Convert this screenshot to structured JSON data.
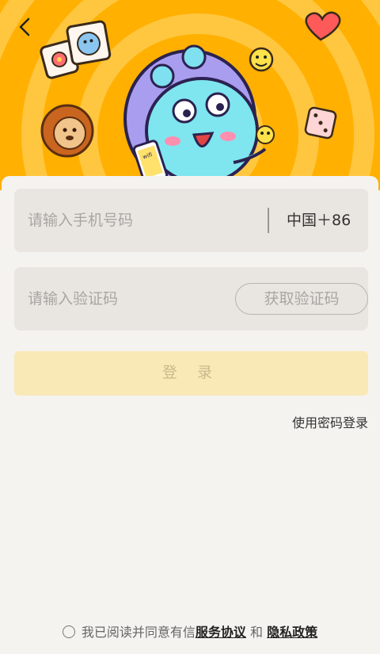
{
  "header": {
    "back_label": ""
  },
  "phone": {
    "placeholder": "请输入手机号码",
    "country_code": "中国＋86"
  },
  "code": {
    "placeholder": "请输入验证码",
    "get_code_label": "获取验证码"
  },
  "login": {
    "label": "登 录"
  },
  "password_login": {
    "label": "使用密码登录"
  },
  "agreement": {
    "prefix": "我已阅读并同意有信",
    "service_link": "服务协议",
    "and": "和",
    "privacy_link": "隐私政策"
  },
  "mascot": {
    "phone_screen_text": "wifi"
  },
  "colors": {
    "hero_bg": "#ffb000",
    "hero_ring": "#ffc640",
    "accent": "#f8e9b6",
    "field_bg": "#e9e6e1"
  }
}
